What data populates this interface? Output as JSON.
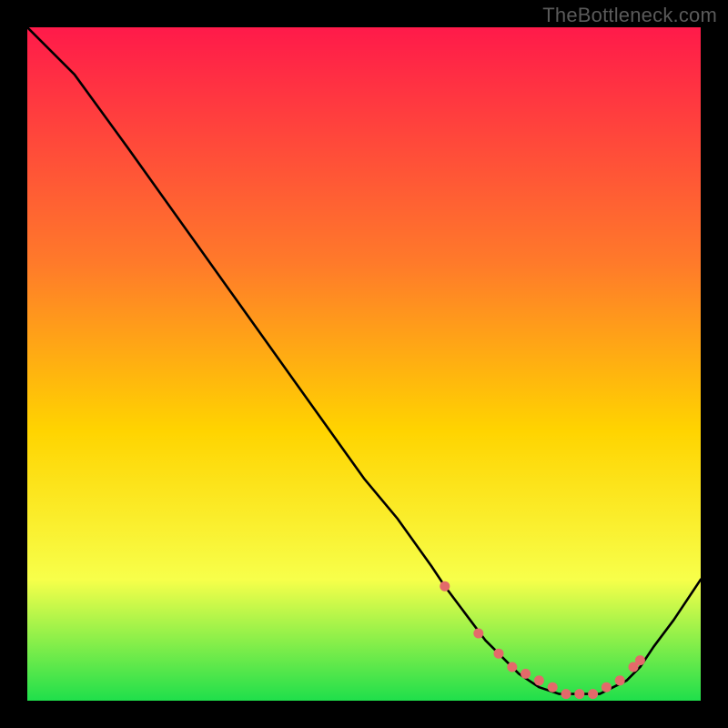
{
  "watermark": "TheBottleneck.com",
  "colors": {
    "bg": "#000000",
    "grad_top": "#ff1a4a",
    "grad_mid1": "#ff7a2a",
    "grad_mid2": "#ffd400",
    "grad_mid3": "#f7ff4a",
    "grad_bot": "#1fdf4b",
    "line": "#000000",
    "marker": "#e36a6a"
  },
  "chart_data": {
    "type": "line",
    "title": "",
    "xlabel": "",
    "ylabel": "",
    "xlim": [
      0,
      100
    ],
    "ylim": [
      0,
      100
    ],
    "grid": false,
    "legend": false,
    "series": [
      {
        "name": "curve",
        "x": [
          0,
          7,
          15,
          20,
          25,
          30,
          35,
          40,
          45,
          50,
          55,
          60,
          62,
          65,
          68,
          70,
          73,
          76,
          79,
          82,
          85,
          87,
          89,
          91,
          93,
          96,
          100
        ],
        "y": [
          100,
          93,
          82,
          75,
          68,
          61,
          54,
          47,
          40,
          33,
          27,
          20,
          17,
          13,
          9,
          7,
          4,
          2,
          1,
          1,
          1,
          2,
          3,
          5,
          8,
          12,
          18
        ]
      }
    ],
    "markers": {
      "name": "flat-zone-dots",
      "x": [
        62,
        67,
        70,
        72,
        74,
        76,
        78,
        80,
        82,
        84,
        86,
        88,
        90,
        91
      ],
      "y": [
        17,
        10,
        7,
        5,
        4,
        3,
        2,
        1,
        1,
        1,
        2,
        3,
        5,
        6
      ]
    }
  }
}
